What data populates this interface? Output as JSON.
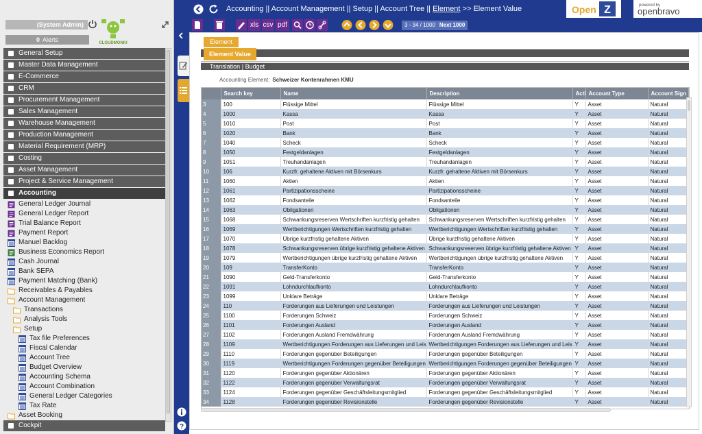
{
  "user": {
    "label": "(System Admin)"
  },
  "alerts": {
    "count": "0",
    "label": "Alerts"
  },
  "logo_text": "CLOUDMONKI",
  "menu": {
    "top": [
      {
        "label": "General Setup",
        "icon": "gear-icon"
      },
      {
        "label": "Master Data Management",
        "icon": "document-icon"
      },
      {
        "label": "E-Commerce",
        "icon": "monitor-icon"
      },
      {
        "label": "CRM",
        "icon": "chat-icon"
      },
      {
        "label": "Procurement Management",
        "icon": "truck-icon"
      },
      {
        "label": "Sales Management",
        "icon": "cart-icon"
      },
      {
        "label": "Warehouse Management",
        "icon": "warehouse-icon"
      },
      {
        "label": "Production Management",
        "icon": "hammer-icon"
      },
      {
        "label": "Material Requirement (MRP)",
        "icon": "hierarchy-icon"
      },
      {
        "label": "Costing",
        "icon": "calculator-icon"
      },
      {
        "label": "Asset Management",
        "icon": "box-icon"
      },
      {
        "label": "Project & Service Management",
        "icon": "clipboard-icon"
      },
      {
        "label": "Accounting",
        "icon": "calculator-icon"
      }
    ],
    "accounting_items": [
      {
        "label": "General Ledger Journal",
        "icon": "report-icon"
      },
      {
        "label": "General Ledger Report",
        "icon": "report-icon"
      },
      {
        "label": "Trial Balance Report",
        "icon": "report-icon"
      },
      {
        "label": "Payment Report",
        "icon": "report-icon"
      },
      {
        "label": "Manuel Backlog",
        "icon": "window-icon"
      },
      {
        "label": "Business Economics Report",
        "icon": "process-icon"
      },
      {
        "label": "Cash Journal",
        "icon": "window-icon"
      },
      {
        "label": "Bank SEPA",
        "icon": "window-icon"
      },
      {
        "label": "Payment Matching (Bank)",
        "icon": "window-icon"
      },
      {
        "label": "Receivables & Payables",
        "icon": "folder-icon"
      },
      {
        "label": "Account Management",
        "icon": "folder-open-icon"
      }
    ],
    "account_mgmt_items": [
      {
        "label": "Transactions",
        "icon": "folder-icon"
      },
      {
        "label": "Analysis Tools",
        "icon": "folder-icon"
      },
      {
        "label": "Setup",
        "icon": "folder-open-icon"
      }
    ],
    "setup_items": [
      {
        "label": "Tax file Preferences",
        "icon": "window-icon"
      },
      {
        "label": "Fiscal Calendar",
        "icon": "window-icon"
      },
      {
        "label": "Account Tree",
        "icon": "window-icon"
      },
      {
        "label": "Budget Overview",
        "icon": "window-icon"
      },
      {
        "label": "Accounting Schema",
        "icon": "window-icon"
      },
      {
        "label": "Account Combination",
        "icon": "window-icon"
      },
      {
        "label": "General Ledger Categories",
        "icon": "window-icon"
      },
      {
        "label": "Tax Rate",
        "icon": "window-icon"
      }
    ],
    "after_items": [
      {
        "label": "Asset Booking",
        "icon": "folder-icon"
      }
    ],
    "bottom": {
      "label": "Cockpit",
      "icon": "dashboard-icon"
    }
  },
  "breadcrumb": {
    "part1": "Accounting || Account Management || Setup || Account Tree  ||",
    "link": "Element",
    "sep": ">>",
    "current": "Element Value"
  },
  "brand": {
    "open": "Open",
    "z": "Z",
    "powered": "powered by",
    "ob": "openbravo"
  },
  "toolbar": {
    "xls": "xls",
    "csv": "csv",
    "pdf": "pdf",
    "pager_range": "3 - 34 / 1000",
    "pager_next": "Next 1000"
  },
  "tabs": {
    "element": "Element",
    "element_value": "Element Value"
  },
  "subtabs": {
    "translation": "Translation",
    "sep": "|",
    "budget": "Budget"
  },
  "accounting_element": {
    "label": "Accounting Element:",
    "value": "Schweizer Kontenrahmen KMU"
  },
  "columns": [
    "Search key",
    "Name",
    "Description",
    "Acti",
    "Account Type",
    "Account Sign"
  ],
  "rows": [
    [
      "3",
      "100",
      "Flüssige Mittel",
      "Flüssige Mittel",
      "Y",
      "Asset",
      "Natural"
    ],
    [
      "4",
      "1000",
      "Kassa",
      "Kassa",
      "Y",
      "Asset",
      "Natural"
    ],
    [
      "5",
      "1010",
      "Post",
      "Post",
      "Y",
      "Asset",
      "Natural"
    ],
    [
      "6",
      "1020",
      "Bank",
      "Bank",
      "Y",
      "Asset",
      "Natural"
    ],
    [
      "7",
      "1040",
      "Scheck",
      "Scheck",
      "Y",
      "Asset",
      "Natural"
    ],
    [
      "8",
      "1050",
      "Festgeldanlagen",
      "Festgeldanlagen",
      "Y",
      "Asset",
      "Natural"
    ],
    [
      "9",
      "1051",
      "Treuhandanlagen",
      "Treuhandanlagen",
      "Y",
      "Asset",
      "Natural"
    ],
    [
      "10",
      "106",
      "Kurzfr. gehaltene Aktiven mit Börsenkurs",
      "Kurzfr. gehaltene Aktiven mit Börsenkurs",
      "Y",
      "Asset",
      "Natural"
    ],
    [
      "11",
      "1060",
      "Aktien",
      "Aktien",
      "Y",
      "Asset",
      "Natural"
    ],
    [
      "12",
      "1061",
      "Partizipationsscheine",
      "Partizipationsscheine",
      "Y",
      "Asset",
      "Natural"
    ],
    [
      "13",
      "1062",
      "Fondsanteile",
      "Fondsanteile",
      "Y",
      "Asset",
      "Natural"
    ],
    [
      "14",
      "1063",
      "Obligationen",
      "Obligationen",
      "Y",
      "Asset",
      "Natural"
    ],
    [
      "15",
      "1068",
      "Schwankungsreserven Wertschriften kurzfristig gehalten",
      "Schwankungsreserven Wertschriften kurzfristig gehalten",
      "Y",
      "Asset",
      "Natural"
    ],
    [
      "16",
      "1069",
      "Wertberichtigungen Wertschriften kurzfristig gehalten",
      "Wertberichtigungen Wertschriften kurzfristig gehalten",
      "Y",
      "Asset",
      "Natural"
    ],
    [
      "17",
      "1070",
      "Übrige kurzfristig gehaltene Aktiven",
      "Übrige kurzfristig gehaltene Aktiven",
      "Y",
      "Asset",
      "Natural"
    ],
    [
      "18",
      "1078",
      "Schwankungsreserven übrige kurzfristig gehaltene Aktiven",
      "Schwankungsreserven übrige kurzfristig gehaltene Aktiven",
      "Y",
      "Asset",
      "Natural"
    ],
    [
      "19",
      "1079",
      "Wertberichtigungen übrige kurzfristig gehaltene Aktiven",
      "Wertberichtigungen übrige kurzfristig gehaltene Aktiven",
      "Y",
      "Asset",
      "Natural"
    ],
    [
      "20",
      "109",
      "TransferKonto",
      "TransferKonto",
      "Y",
      "Asset",
      "Natural"
    ],
    [
      "21",
      "1090",
      "Geld-Transferkonto",
      "Geld-Transferkonto",
      "Y",
      "Asset",
      "Natural"
    ],
    [
      "22",
      "1091",
      "Lohndurchlaufkonto",
      "Lohndurchlaufkonto",
      "Y",
      "Asset",
      "Natural"
    ],
    [
      "23",
      "1099",
      "Unklare Beträge",
      "Unklare Beträge",
      "Y",
      "Asset",
      "Natural"
    ],
    [
      "24",
      "110",
      "Forderungen aus Lieferungen und Leistungen",
      "Forderungen aus Lieferungen und Leistungen",
      "Y",
      "Asset",
      "Natural"
    ],
    [
      "25",
      "1100",
      "Forderungen Schweiz",
      "Forderungen Schweiz",
      "Y",
      "Asset",
      "Natural"
    ],
    [
      "26",
      "1101",
      "Forderungen Ausland",
      "Forderungen Ausland",
      "Y",
      "Asset",
      "Natural"
    ],
    [
      "27",
      "1102",
      "Forderungen Ausland Fremdwährung",
      "Forderungen Ausland Fremdwährung",
      "Y",
      "Asset",
      "Natural"
    ],
    [
      "28",
      "1109",
      "Wertberichtigungen Forderungen aus Lieferungen und Leistungen",
      "Wertberichtigungen Forderungen aus Lieferungen und Leistungen",
      "Y",
      "Asset",
      "Natural"
    ],
    [
      "29",
      "1110",
      "Forderungen gegenüber Beteiligungen",
      "Forderungen gegenüber Beteiligungen",
      "Y",
      "Asset",
      "Natural"
    ],
    [
      "30",
      "1119",
      "Wertberichtigungen Forderungen gegenüber Beteiligungen",
      "Wertberichtigungen Forderungen gegenüber Beteiligungen",
      "Y",
      "Asset",
      "Natural"
    ],
    [
      "31",
      "1120",
      "Forderungen gegenüber Aktionären",
      "Forderungen gegenüber Aktionären",
      "Y",
      "Asset",
      "Natural"
    ],
    [
      "32",
      "1122",
      "Forderungen gegenüber Verwaltungsrat",
      "Forderungen gegenüber Verwaltungsrat",
      "Y",
      "Asset",
      "Natural"
    ],
    [
      "33",
      "1124",
      "Forderungen gegenüber Geschäftsleitungsmitglied",
      "Forderungen gegenüber Geschäftsleitungsmitglied",
      "Y",
      "Asset",
      "Natural"
    ],
    [
      "34",
      "1128",
      "Forderungen gegenüber Revisionstelle",
      "Forderungen gegenüber Revisionstelle",
      "Y",
      "Asset",
      "Natural"
    ]
  ]
}
